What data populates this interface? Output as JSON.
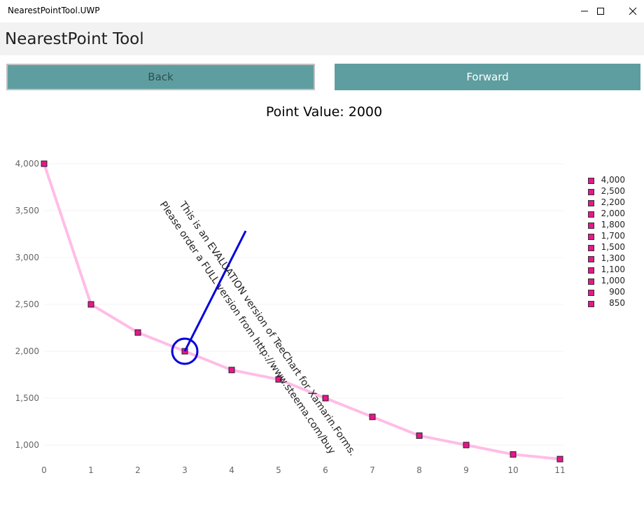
{
  "window": {
    "title": "NearestPointTool.UWP",
    "controls": [
      "minimize-icon",
      "maximize-icon",
      "close-icon"
    ]
  },
  "header": {
    "title": "NearestPoint Tool"
  },
  "buttons": {
    "back": "Back",
    "forward": "Forward"
  },
  "point_value_text": "Point Value: 2000",
  "watermark": {
    "line1": "This is an EVALUATION version of TeeChart for Xamarin.Forms.",
    "line2": "Please order a FULL version from http://www.steema.com/buy"
  },
  "colors": {
    "button": "#5f9ea0",
    "line": "#ffbde6",
    "marker": "#e8168c",
    "nearest_tool": "#0000dd"
  },
  "chart_data": {
    "type": "line",
    "x": [
      0,
      1,
      2,
      3,
      4,
      5,
      6,
      7,
      8,
      9,
      10,
      11
    ],
    "series": [
      {
        "values": [
          4000,
          2500,
          2200,
          2000,
          1800,
          1700,
          1500,
          1300,
          1100,
          1000,
          900,
          850
        ]
      }
    ],
    "x_ticks": [
      "0",
      "1",
      "2",
      "3",
      "4",
      "5",
      "6",
      "7",
      "8",
      "9",
      "10",
      "11"
    ],
    "y_ticks": [
      "1,000",
      "1,500",
      "2,000",
      "2,500",
      "3,000",
      "3,500",
      "4,000"
    ],
    "y_tick_values": [
      1000,
      1500,
      2000,
      2500,
      3000,
      3500,
      4000
    ],
    "xlim": [
      0,
      11
    ],
    "ylim": [
      850,
      4000
    ],
    "grid": true,
    "legend_position": "right",
    "legend": [
      "4,000",
      "2,500",
      "2,200",
      "2,000",
      "1,800",
      "1,700",
      "1,500",
      "1,300",
      "1,100",
      "1,000",
      "900",
      "850"
    ],
    "nearest_point": {
      "x": 3,
      "y": 2000
    }
  }
}
